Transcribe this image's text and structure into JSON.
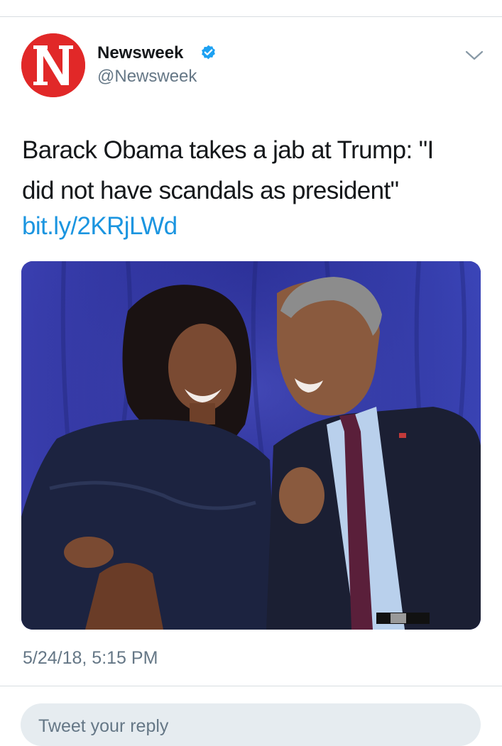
{
  "tweet": {
    "account": {
      "name": "Newsweek",
      "handle": "@Newsweek",
      "verified": true,
      "avatar_letter": "N",
      "avatar_color": "#e12828"
    },
    "text_lines": [
      "Barack Obama takes a jab at Trump: \"I",
      "did not have scandals as president\""
    ],
    "link": "bit.ly/2KRjLWd",
    "media": {
      "icon": "photo-image"
    },
    "timestamp": "5/24/18, 5:15 PM"
  },
  "reply": {
    "placeholder": "Tweet your reply"
  },
  "colors": {
    "link": "#1b95e0",
    "secondary_text": "#657786",
    "verified_badge": "#1da1f2",
    "divider": "#d8dde1",
    "reply_bg": "#e6ecf0"
  },
  "icons": {
    "verified": "verified-badge-icon",
    "more": "chevron-down-icon"
  }
}
